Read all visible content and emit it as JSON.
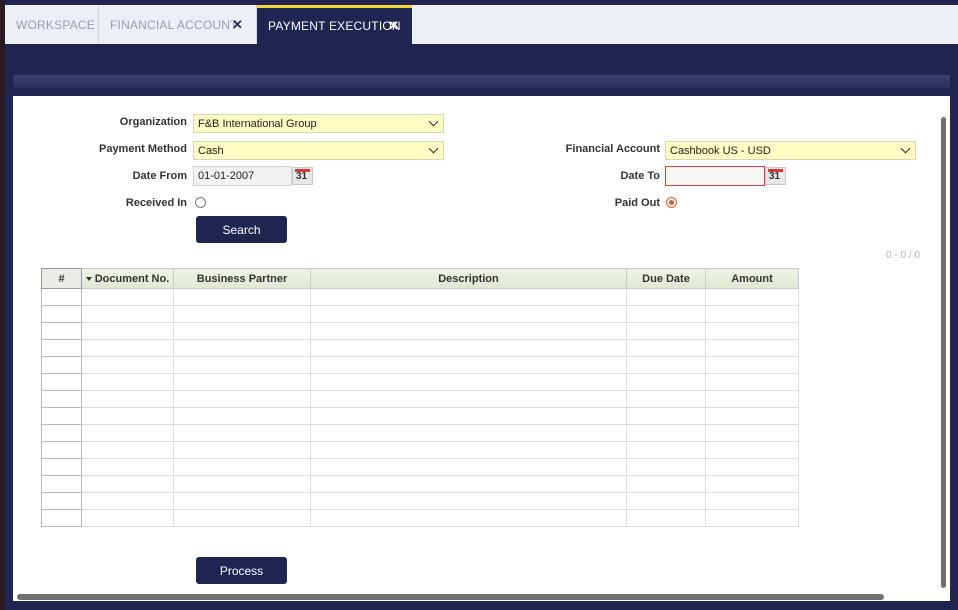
{
  "tabs": [
    {
      "label": "WORKSPACE",
      "closable": false
    },
    {
      "label": "FINANCIAL ACCOUNT",
      "closable": true
    },
    {
      "label": "PAYMENT EXECUTION",
      "closable": true,
      "active": true
    }
  ],
  "form": {
    "organization": {
      "label": "Organization",
      "value": "F&B International Group"
    },
    "payment_method": {
      "label": "Payment Method",
      "value": "Cash"
    },
    "financial_account": {
      "label": "Financial Account",
      "value": "Cashbook US - USD"
    },
    "date_from": {
      "label": "Date From",
      "value": "01-01-2007"
    },
    "date_to": {
      "label": "Date To",
      "value": ""
    },
    "received_in": {
      "label": "Received In",
      "checked": false
    },
    "paid_out": {
      "label": "Paid Out",
      "checked": true
    },
    "calendar_day": "31"
  },
  "buttons": {
    "search": "Search",
    "process": "Process"
  },
  "pager": "0 - 0 / 0",
  "grid": {
    "columns": [
      "#",
      "Document No.",
      "Business Partner",
      "Description",
      "Due Date",
      "Amount"
    ],
    "empty_rows": 14
  },
  "colors": {
    "nav": "#1f2451",
    "accent": "#f3d33a",
    "required": "#e33b3b",
    "field_bg": "#fdfcc2"
  },
  "icons": [
    "close-icon",
    "chevron-down-icon",
    "calendar-icon",
    "sort-desc-icon"
  ]
}
